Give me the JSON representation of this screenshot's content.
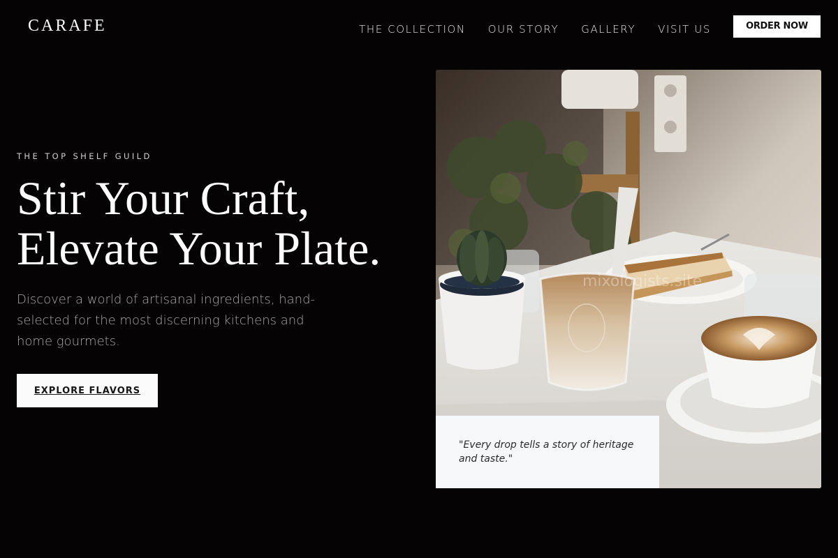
{
  "brand": {
    "logo": "CARAFE"
  },
  "nav": {
    "items": [
      {
        "label": "THE COLLECTION"
      },
      {
        "label": "OUR STORY"
      },
      {
        "label": "GALLERY"
      },
      {
        "label": "VISIT US"
      }
    ],
    "order_label": "ORDER NOW"
  },
  "hero": {
    "eyebrow": "THE TOP SHELF GUILD",
    "headline_line1": "Stir Your Craft,",
    "headline_line2": "Elevate Your Plate.",
    "lead": "Discover a world of artisanal ingredients, hand-selected for the most discerning kitchens and home gourmets.",
    "cta_label": "EXPLORE FLAVORS"
  },
  "feature": {
    "watermark": "mixologists.site",
    "quote": "\"Every drop tells a story of heritage and taste.\""
  },
  "colors": {
    "background": "#050304",
    "accent_button": "#ffffff",
    "muted_text": "#a9a8a9"
  }
}
